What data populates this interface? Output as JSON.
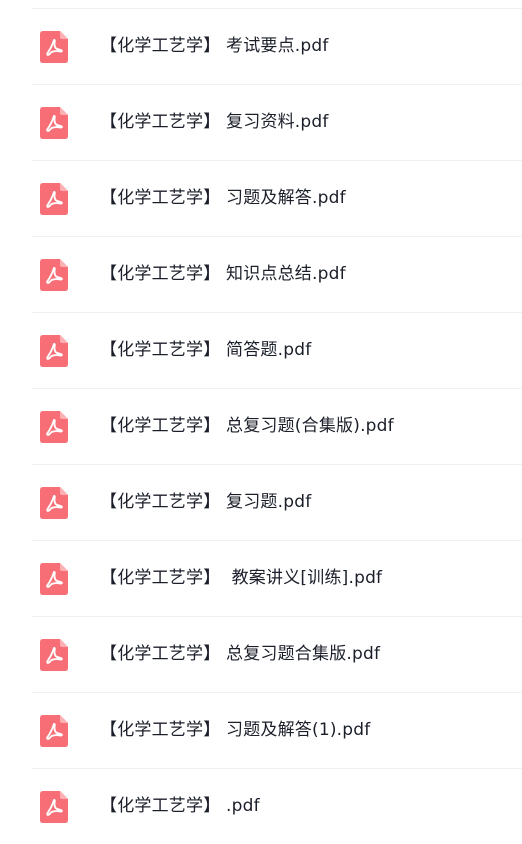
{
  "files": [
    {
      "name": "【化学工艺学】 考试要点.pdf",
      "icon": "pdf-file-icon"
    },
    {
      "name": "【化学工艺学】 复习资料.pdf",
      "icon": "pdf-file-icon"
    },
    {
      "name": "【化学工艺学】 习题及解答.pdf",
      "icon": "pdf-file-icon"
    },
    {
      "name": "【化学工艺学】 知识点总结.pdf",
      "icon": "pdf-file-icon"
    },
    {
      "name": "【化学工艺学】 简答题.pdf",
      "icon": "pdf-file-icon"
    },
    {
      "name": "【化学工艺学】 总复习题(合集版).pdf",
      "icon": "pdf-file-icon"
    },
    {
      "name": "【化学工艺学】 复习题.pdf",
      "icon": "pdf-file-icon"
    },
    {
      "name": "【化学工艺学】  教案讲义[训练].pdf",
      "icon": "pdf-file-icon"
    },
    {
      "name": "【化学工艺学】 总复习题合集版.pdf",
      "icon": "pdf-file-icon"
    },
    {
      "name": "【化学工艺学】 习题及解答(1).pdf",
      "icon": "pdf-file-icon"
    },
    {
      "name": "【化学工艺学】 .pdf",
      "icon": "pdf-file-icon"
    }
  ],
  "colors": {
    "icon_bg": "#f86e76",
    "icon_fold": "#fbb0b4",
    "text": "#1b1f2a",
    "divider": "#f0f0f2"
  }
}
